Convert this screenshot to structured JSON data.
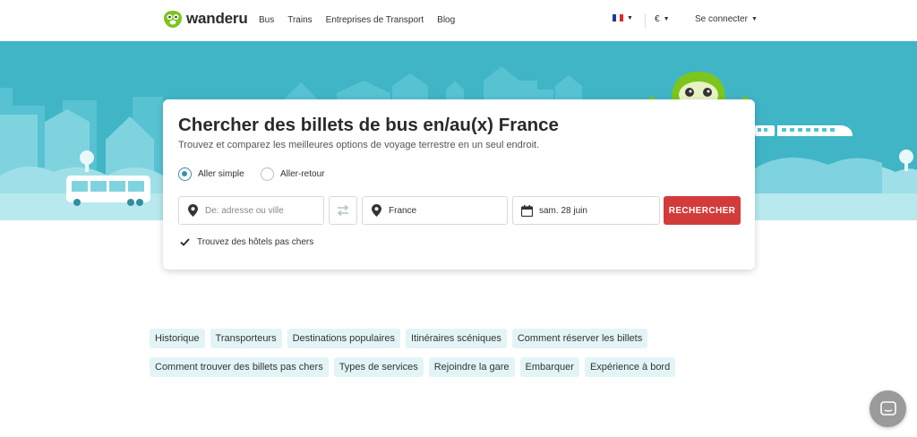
{
  "header": {
    "brand": "wanderu",
    "nav": [
      "Bus",
      "Trains",
      "Entreprises de Transport",
      "Blog"
    ],
    "currency": "€",
    "login": "Se connecter",
    "language_flag": "france-flag-icon"
  },
  "search": {
    "title": "Chercher des billets de bus en/au(x) France",
    "subtitle": "Trouvez et comparez les meilleures options de voyage terrestre en un seul endroit.",
    "trip_types": [
      "Aller simple",
      "Aller-retour"
    ],
    "selected_trip_type": "Aller simple",
    "from_placeholder": "De: adresse ou ville",
    "to_value": "France",
    "date_value": "sam. 28 juin",
    "button": "RECHERCHER",
    "hotels_checkbox": "Trouvez des hôtels pas chers",
    "hotels_checked": true
  },
  "chips_row1": [
    "Historique",
    "Transporteurs",
    "Destinations populaires",
    "Itinéraires scéniques",
    "Comment réserver les billets"
  ],
  "chips_row2": [
    "Comment trouver des billets pas chers",
    "Types de services",
    "Rejoindre la gare",
    "Embarquer",
    "Expérience à bord"
  ],
  "colors": {
    "hero": "#40b5c6",
    "accent": "#d33b3b",
    "chip_bg": "#e3f4f6",
    "mascot": "#7cc51d"
  }
}
